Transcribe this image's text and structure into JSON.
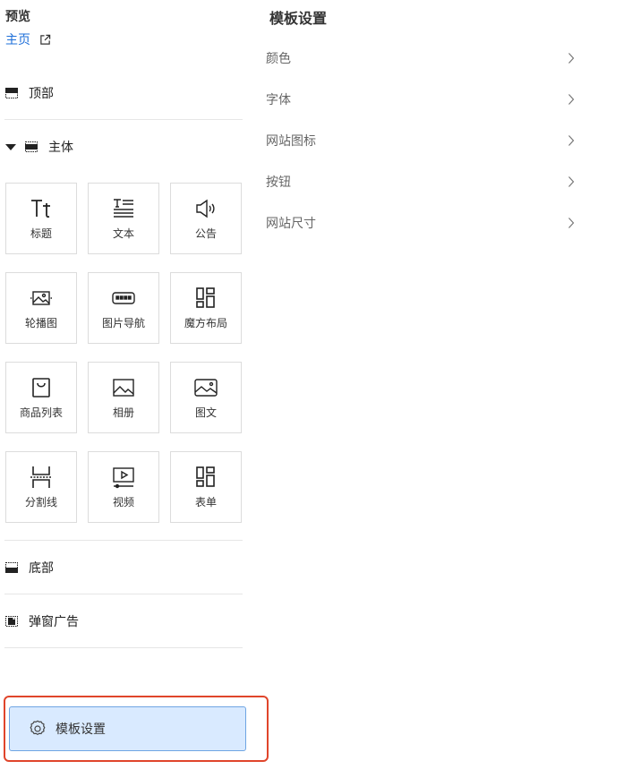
{
  "preview": {
    "label": "预览",
    "home_link": "主页"
  },
  "sections": {
    "top": "顶部",
    "body": "主体",
    "bottom": "底部",
    "popup_ad": "弹窗广告"
  },
  "components": [
    {
      "label": "标题",
      "icon": "title-icon"
    },
    {
      "label": "文本",
      "icon": "text-icon"
    },
    {
      "label": "公告",
      "icon": "announcement-icon"
    },
    {
      "label": "轮播图",
      "icon": "carousel-icon"
    },
    {
      "label": "图片导航",
      "icon": "image-nav-icon"
    },
    {
      "label": "魔方布局",
      "icon": "cube-layout-icon"
    },
    {
      "label": "商品列表",
      "icon": "product-list-icon"
    },
    {
      "label": "相册",
      "icon": "album-icon"
    },
    {
      "label": "图文",
      "icon": "image-text-icon"
    },
    {
      "label": "分割线",
      "icon": "divider-icon"
    },
    {
      "label": "视频",
      "icon": "video-icon"
    },
    {
      "label": "表单",
      "icon": "form-icon"
    }
  ],
  "template_button": {
    "label": "模板设置",
    "icon": "gear-icon"
  },
  "settings_panel": {
    "title": "模板设置",
    "items": [
      "颜色",
      "字体",
      "网站图标",
      "按钮",
      "网站尺寸"
    ]
  },
  "colors": {
    "link": "#1e6fd9",
    "highlight_border": "#e0452b",
    "button_bg": "#d9eaff"
  }
}
